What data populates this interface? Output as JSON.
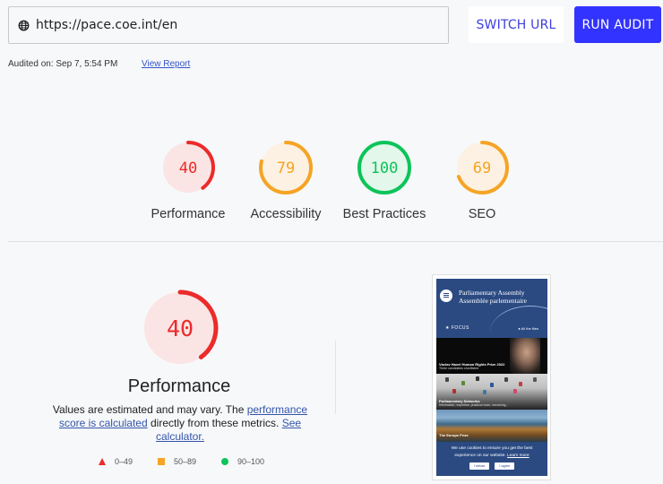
{
  "toolbar": {
    "url": "https://pace.coe.int/en",
    "switch_url_label": "SWITCH URL",
    "run_audit_label": "RUN AUDIT"
  },
  "audit_info": {
    "audited_on": "Audited on: Sep 7, 5:54 PM",
    "view_report_label": "View Report"
  },
  "summary_gauges": [
    {
      "label": "Performance",
      "score": 40,
      "status": "fail"
    },
    {
      "label": "Accessibility",
      "score": 79,
      "status": "average"
    },
    {
      "label": "Best Practices",
      "score": 100,
      "status": "pass"
    },
    {
      "label": "SEO",
      "score": 69,
      "status": "average"
    }
  ],
  "detail": {
    "title": "Performance",
    "score": 40,
    "status": "fail",
    "description_prefix": "Values are estimated and may vary. The ",
    "link1": "performance score is calculated",
    "description_middle": " directly from these metrics. ",
    "link2": "See calculator."
  },
  "legend": [
    {
      "shape": "triangle",
      "range": "0–49",
      "status": "fail"
    },
    {
      "shape": "square",
      "range": "50–89",
      "status": "average"
    },
    {
      "shape": "circle",
      "range": "90–100",
      "status": "pass"
    }
  ],
  "colors": {
    "fail": "#eb2b2b",
    "fail_bg": "#fbe4e4",
    "average": "#f5a425",
    "average_bg": "#fcf1e2",
    "pass": "#0cc45a",
    "pass_bg": "#e3f7ea",
    "accent": "#3333ff"
  },
  "screenshot": {
    "site_title_line1": "Parliamentary Assembly",
    "site_title_line2": "Assemblée parlementaire",
    "focus_label": "★ FOCUS",
    "all_files_label": "● All the files",
    "hero_caption": "Václav Havel Human Rights Prize 2022",
    "hero_subcaption": "Three candidates shortlisted",
    "network_caption": "Parliamentary Networks",
    "network_subcaption": "Information, expertise, practical tools, mentoring...",
    "prize_caption": "The Europe Prize",
    "cookie_text_1": "We use cookies to ensure you get the best",
    "cookie_text_2": "experience on our website.",
    "cookie_learn_more": "Learn more",
    "cookie_refuse": "I refuse",
    "cookie_agree": "I agree"
  }
}
